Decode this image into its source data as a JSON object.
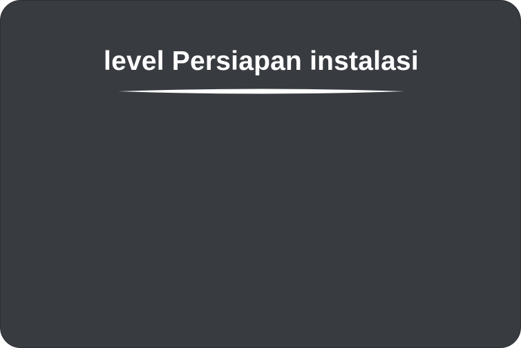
{
  "card": {
    "title": "level Persiapan instalasi",
    "background_color": "#383b40",
    "text_color": "#ffffff"
  }
}
